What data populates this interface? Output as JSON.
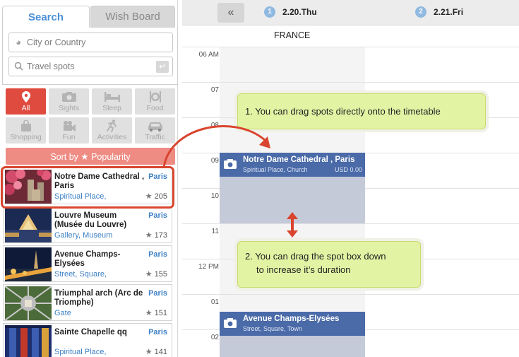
{
  "tabs": {
    "search": "Search",
    "wish_board": "Wish Board"
  },
  "search": {
    "city_placeholder": "City or Country",
    "spots_placeholder": "Travel spots"
  },
  "categories": [
    {
      "label": "All",
      "icon": "map-pin-icon",
      "active": true
    },
    {
      "label": "Sights",
      "icon": "camera-icon",
      "active": false
    },
    {
      "label": "Sleep",
      "icon": "bed-icon",
      "active": false
    },
    {
      "label": "Food",
      "icon": "utensils-icon",
      "active": false
    },
    {
      "label": "Shopping",
      "icon": "shopping-bag-icon",
      "active": false
    },
    {
      "label": "Fun",
      "icon": "film-icon",
      "active": false
    },
    {
      "label": "Activities",
      "icon": "running-icon",
      "active": false
    },
    {
      "label": "Traffic",
      "icon": "car-icon",
      "active": false
    }
  ],
  "sort_label": "Sort by ★ Popularity",
  "spots": [
    {
      "name": "Notre Dame Cathedral , Paris",
      "city": "Paris",
      "category": "Spiritual Place,",
      "rating": "205"
    },
    {
      "name": "Louvre Museum (Musée du Louvre)",
      "city": "Paris",
      "category": "Gallery, Museum",
      "rating": "173"
    },
    {
      "name": "Avenue Champs-Elysées",
      "city": "Paris",
      "category": "Street, Square,",
      "rating": "155"
    },
    {
      "name": "Triumphal arch (Arc de Triomphe)",
      "city": "Paris",
      "category": "Gate",
      "rating": "151"
    },
    {
      "name": "Sainte Chapelle qq",
      "city": "Paris",
      "category": "Spiritual Place,",
      "rating": "141"
    }
  ],
  "timetable": {
    "collapse_label": "«",
    "days": [
      {
        "num": "1",
        "label": "2.20.Thu"
      },
      {
        "num": "2",
        "label": "2.21.Fri"
      }
    ],
    "country": "FRANCE",
    "hours": [
      "06 AM",
      "07",
      "08",
      "09",
      "10",
      "11",
      "12 PM",
      "01",
      "02"
    ],
    "blocks": [
      {
        "name": "Notre Dame Cathedral , Paris",
        "category": "Spiritual Place, Church",
        "price": "USD 0.00"
      },
      {
        "name": "Avenue Champs-Elysées",
        "category": "Street, Square, Town",
        "price": ""
      }
    ]
  },
  "tips": {
    "tip1": "1. You can drag spots directly onto the timetable",
    "tip2_line1": "2. You can drag the spot box down",
    "tip2_line2": "to increase it’s duration"
  },
  "colors": {
    "accent_red": "#e04b3f",
    "link_blue": "#3b7fc4",
    "block_blue": "#4a6aa8",
    "tip_green": "#e3f3a4"
  }
}
